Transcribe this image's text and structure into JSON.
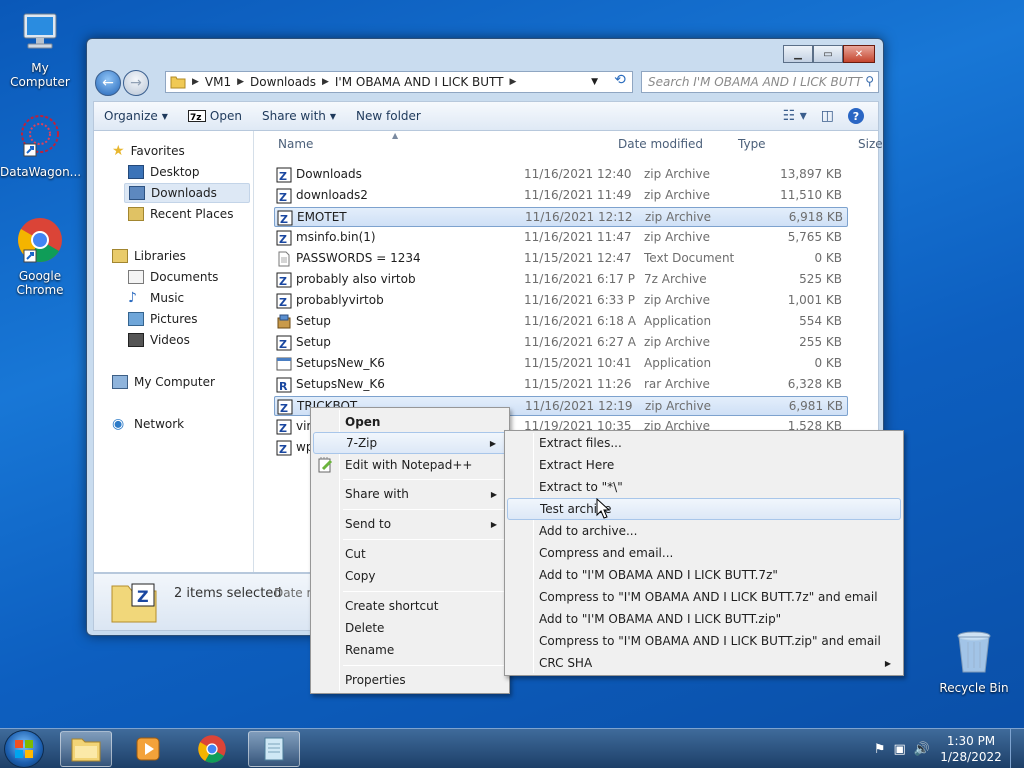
{
  "desktop": {
    "icons": [
      {
        "label": "My Computer"
      },
      {
        "label": "DataWagon..."
      },
      {
        "label": "Google Chrome"
      },
      {
        "label": "Recycle Bin"
      }
    ]
  },
  "address": {
    "crumbs": [
      "VM1",
      "Downloads",
      "I'M OBAMA AND I LICK BUTT"
    ],
    "search_placeholder": "Search I'M OBAMA AND I LICK BUTT"
  },
  "toolbar": {
    "organize": "Organize",
    "open": "Open",
    "share_with": "Share with",
    "new_folder": "New folder"
  },
  "nav": {
    "favorites": "Favorites",
    "desktop": "Desktop",
    "downloads": "Downloads",
    "recent_places": "Recent Places",
    "libraries": "Libraries",
    "documents": "Documents",
    "music": "Music",
    "pictures": "Pictures",
    "videos": "Videos",
    "my_computer": "My Computer",
    "network": "Network"
  },
  "columns": {
    "name": "Name",
    "date": "Date modified",
    "type": "Type",
    "size": "Size"
  },
  "files": [
    {
      "name": "Downloads",
      "date": "11/16/2021 12:40 ...",
      "type": "zip Archive",
      "size": "13,897 KB"
    },
    {
      "name": "downloads2",
      "date": "11/16/2021 11:49 ...",
      "type": "zip Archive",
      "size": "11,510 KB"
    },
    {
      "name": "EMOTET",
      "date": "11/16/2021 12:12 ...",
      "type": "zip Archive",
      "size": "6,918 KB"
    },
    {
      "name": "msinfo.bin(1)",
      "date": "11/16/2021 11:47 ...",
      "type": "zip Archive",
      "size": "5,765 KB"
    },
    {
      "name": "PASSWORDS = 1234",
      "date": "11/15/2021 12:47 ...",
      "type": "Text Document",
      "size": "0 KB"
    },
    {
      "name": "probably also virtob",
      "date": "11/16/2021 6:17 PM",
      "type": "7z Archive",
      "size": "525 KB"
    },
    {
      "name": "probablyvirtob",
      "date": "11/16/2021 6:33 PM",
      "type": "zip Archive",
      "size": "1,001 KB"
    },
    {
      "name": "Setup",
      "date": "11/16/2021 6:18 AM",
      "type": "Application",
      "size": "554 KB"
    },
    {
      "name": "Setup",
      "date": "11/16/2021 6:27 AM",
      "type": "zip Archive",
      "size": "255 KB"
    },
    {
      "name": "SetupsNew_K6",
      "date": "11/15/2021 10:41 ...",
      "type": "Application",
      "size": "0 KB"
    },
    {
      "name": "SetupsNew_K6",
      "date": "11/15/2021 11:26 ...",
      "type": "rar Archive",
      "size": "6,328 KB"
    },
    {
      "name": "TRICKBOT",
      "date": "11/16/2021 12:19 ...",
      "type": "zip Archive",
      "size": "6,981 KB"
    },
    {
      "name": "virt",
      "date": "11/19/2021 10:35 ...",
      "type": "zip Archive",
      "size": "1,528 KB"
    },
    {
      "name": "wp",
      "date": "",
      "type": "",
      "size": ""
    }
  ],
  "details": {
    "count": "2 items selected",
    "date_label": "Date m"
  },
  "context_menu": {
    "open": "Open",
    "sevenzip": "7-Zip",
    "notepad": "Edit with Notepad++",
    "share_with": "Share with",
    "send_to": "Send to",
    "cut": "Cut",
    "copy": "Copy",
    "create_shortcut": "Create shortcut",
    "delete": "Delete",
    "rename": "Rename",
    "properties": "Properties"
  },
  "sevenzip_menu": [
    "Extract files...",
    "Extract Here",
    "Extract to \"*\\\"",
    "Test archive",
    "Add to archive...",
    "Compress and email...",
    "Add to \"I'M OBAMA AND I LICK BUTT.7z\"",
    "Compress to \"I'M OBAMA AND I LICK BUTT.7z\" and email",
    "Add to \"I'M OBAMA AND I LICK BUTT.zip\"",
    "Compress to \"I'M OBAMA AND I LICK BUTT.zip\" and email",
    "CRC SHA"
  ],
  "clock": {
    "time": "1:30 PM",
    "date": "1/28/2022"
  }
}
